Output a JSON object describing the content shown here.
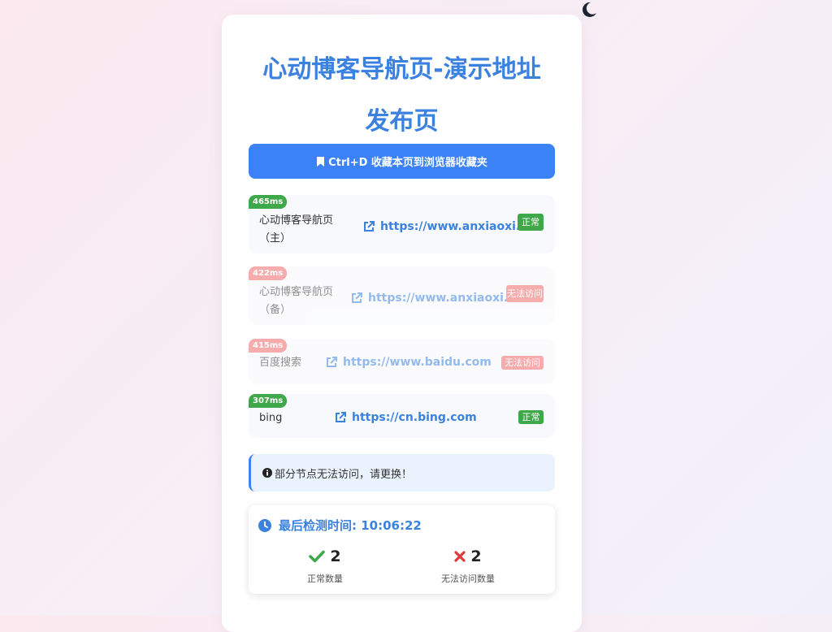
{
  "header": {
    "title": "心动博客导航页-演示地址发布页",
    "bookmark_label": "Ctrl+D 收藏本页到浏览器收藏夹"
  },
  "nodes": [
    {
      "latency": "465ms",
      "name": "心动博客导航页（主）",
      "url": "https://www.anxiaoxi.cc",
      "status": "正常",
      "ok": true
    },
    {
      "latency": "422ms",
      "name": "心动博客导航页（备）",
      "url": "https://www.anxiaoxi.cc",
      "status": "无法访问",
      "ok": false
    },
    {
      "latency": "415ms",
      "name": "百度搜索",
      "url": "https://www.baidu.com",
      "status": "无法访问",
      "ok": false
    },
    {
      "latency": "307ms",
      "name": "bing",
      "url": "https://cn.bing.com",
      "status": "正常",
      "ok": true
    }
  ],
  "notice": {
    "text": "部分节点无法访问，请更换！"
  },
  "stats": {
    "check_time": "最后检测时间: 10:06:22",
    "ok_count": "2",
    "ok_label": "正常数量",
    "fail_count": "2",
    "fail_label": "无法访问数量"
  },
  "colors": {
    "accent": "#3b82f6",
    "ok": "#3fa84a",
    "bad": "#ef6a6a",
    "fail_icon": "#e03a3a"
  },
  "icons": {
    "theme_toggle": "moon-icon",
    "bookmark": "bookmark-icon",
    "link": "external-link-icon",
    "notice": "info-icon",
    "time": "clock-icon",
    "ok": "check-icon",
    "fail": "x-icon"
  }
}
